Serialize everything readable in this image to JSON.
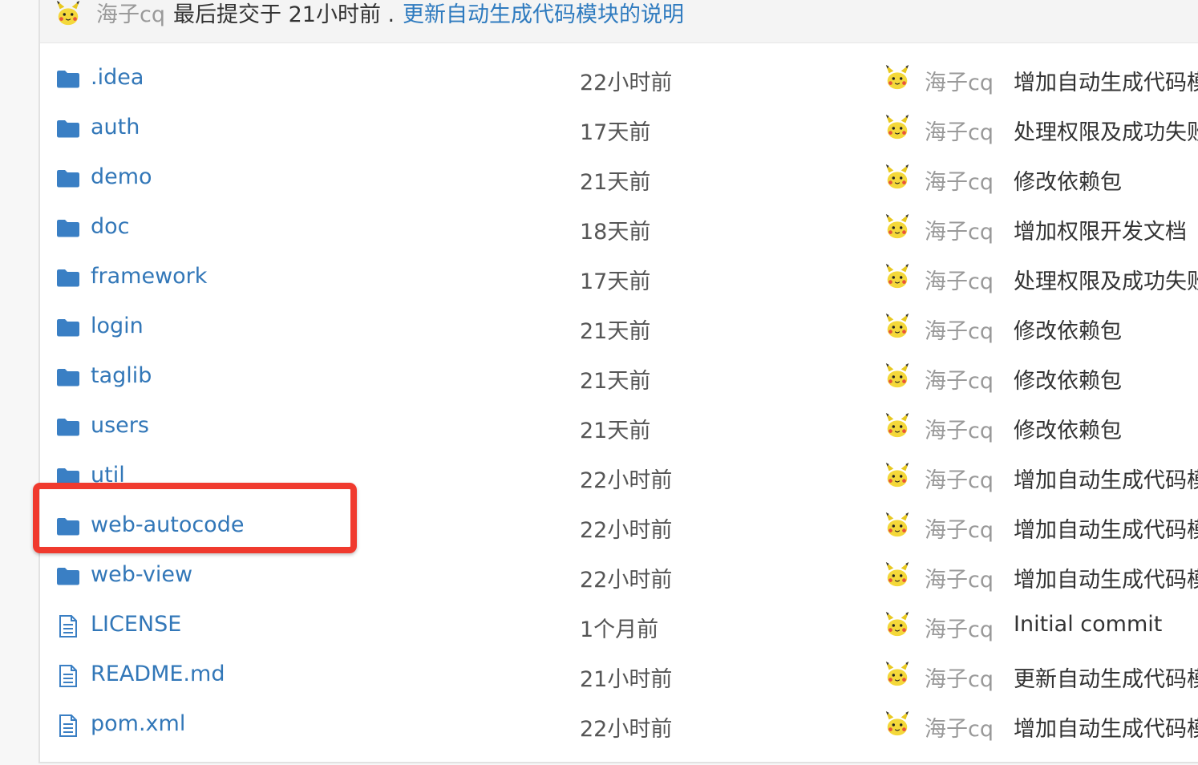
{
  "last_commit": {
    "author": "海子cq",
    "prefix": "最后提交于 21小时前 .",
    "message": "更新自动生成代码模块的说明"
  },
  "colors": {
    "link": "#3277b8",
    "folder_icon": "#3a7fc4",
    "highlight_box": "#f03a2e"
  },
  "files": [
    {
      "icon": "folder-icon",
      "name": ".idea",
      "time": "22小时前",
      "author": "海子cq",
      "message": "增加自动生成代码模"
    },
    {
      "icon": "folder-icon",
      "name": "auth",
      "time": "17天前",
      "author": "海子cq",
      "message": "处理权限及成功失败"
    },
    {
      "icon": "folder-icon",
      "name": "demo",
      "time": "21天前",
      "author": "海子cq",
      "message": "修改依赖包"
    },
    {
      "icon": "folder-icon",
      "name": "doc",
      "time": "18天前",
      "author": "海子cq",
      "message": "增加权限开发文档"
    },
    {
      "icon": "folder-icon",
      "name": "framework",
      "time": "17天前",
      "author": "海子cq",
      "message": "处理权限及成功失败"
    },
    {
      "icon": "folder-icon",
      "name": "login",
      "time": "21天前",
      "author": "海子cq",
      "message": "修改依赖包"
    },
    {
      "icon": "folder-icon",
      "name": "taglib",
      "time": "21天前",
      "author": "海子cq",
      "message": "修改依赖包"
    },
    {
      "icon": "folder-icon",
      "name": "users",
      "time": "21天前",
      "author": "海子cq",
      "message": "修改依赖包"
    },
    {
      "icon": "folder-icon",
      "name": "util",
      "time": "22小时前",
      "author": "海子cq",
      "message": "增加自动生成代码模"
    },
    {
      "icon": "folder-icon",
      "name": "web-autocode",
      "time": "22小时前",
      "author": "海子cq",
      "message": "增加自动生成代码模"
    },
    {
      "icon": "folder-icon",
      "name": "web-view",
      "time": "22小时前",
      "author": "海子cq",
      "message": "增加自动生成代码模"
    },
    {
      "icon": "file-icon",
      "name": "LICENSE",
      "time": "1个月前",
      "author": "海子cq",
      "message": "Initial commit"
    },
    {
      "icon": "file-icon",
      "name": "README.md",
      "time": "21小时前",
      "author": "海子cq",
      "message": "更新自动生成代码模"
    },
    {
      "icon": "file-icon",
      "name": "pom.xml",
      "time": "22小时前",
      "author": "海子cq",
      "message": "增加自动生成代码模"
    }
  ]
}
